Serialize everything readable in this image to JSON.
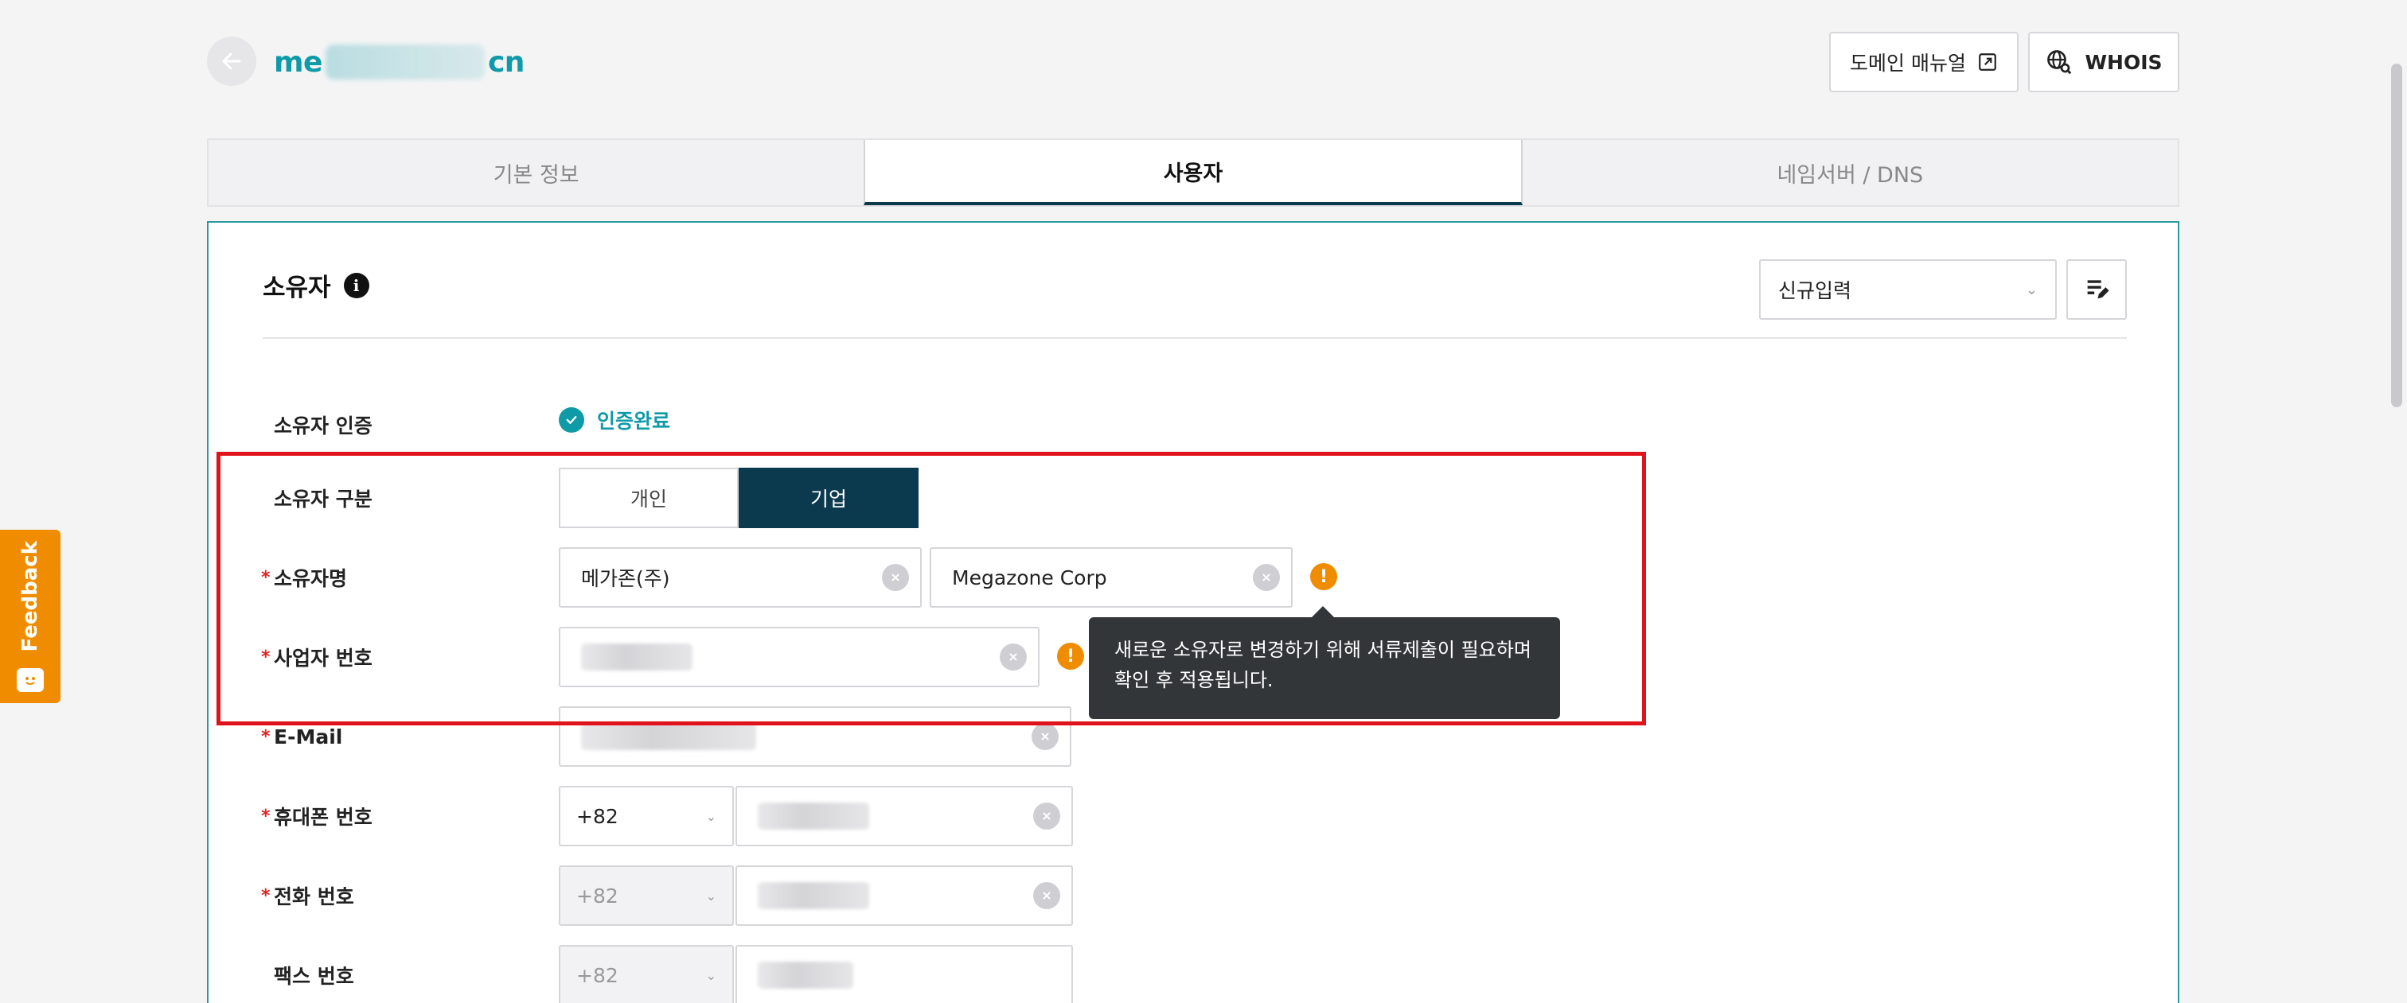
{
  "header": {
    "domain_prefix": "me",
    "domain_suffix": "cn",
    "manual_button": "도메인 매뉴얼",
    "whois_button": "WHOIS"
  },
  "tabs": [
    {
      "label": "기본 정보",
      "active": false
    },
    {
      "label": "사용자",
      "active": true
    },
    {
      "label": "네임서버 / DNS",
      "active": false
    }
  ],
  "card": {
    "title": "소유자",
    "select_value": "신규입력"
  },
  "form": {
    "verify_label": "소유자 인증",
    "verify_status": "인증완료",
    "type_label": "소유자 구분",
    "type_options": [
      "개인",
      "기업"
    ],
    "type_selected": "기업",
    "name_label": "소유자명",
    "name_kr": "메가존(주)",
    "name_en": "Megazone Corp",
    "bizno_label": "사업자 번호",
    "email_label": "E-Mail",
    "mobile_label": "휴대폰 번호",
    "mobile_code": "+82",
    "phone_label": "전화 번호",
    "phone_code": "+82",
    "fax_label": "팩스 번호",
    "fax_code": "+82",
    "required_mark": "*"
  },
  "tooltip": {
    "text": "새로운 소유자로 변경하기 위해 서류제출이 필요하며 확인 후 적용됩니다."
  },
  "feedback": {
    "label": "Feedback"
  },
  "colors": {
    "accent": "#0e9aa7",
    "primary_dark": "#0b3a4e",
    "warning": "#f08c00",
    "highlight": "#e0121c"
  }
}
